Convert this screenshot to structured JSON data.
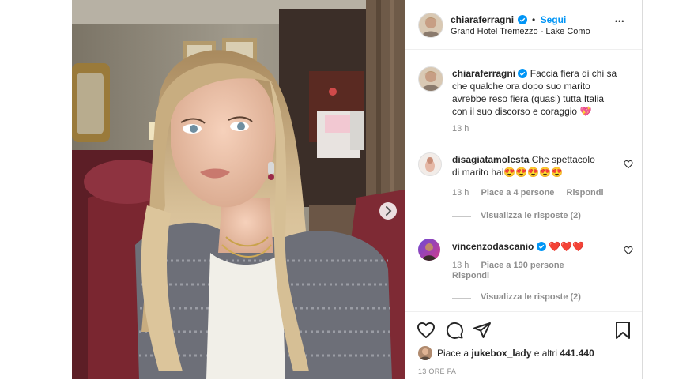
{
  "post": {
    "username": "chiaraferragni",
    "follow_label": "Segui",
    "location": "Grand Hotel Tremezzo - Lake Como",
    "more_label": "•••"
  },
  "caption": {
    "username": "chiaraferragni",
    "text_lines": [
      "Faccia fiera di chi sa",
      "che qualche ora dopo suo marito",
      "avrebbe reso fiera (quasi) tutta Italia",
      "con il suo discorso e coraggio"
    ],
    "emoji": "💖",
    "time": "13 h"
  },
  "comments": [
    {
      "username": "disagiatamolesta",
      "line1": "Che spettacolo",
      "line2": "di marito hai😍😍😍😍😍",
      "time": "13 h",
      "likes": "Piace a 4 persone",
      "reply": "Rispondi",
      "view_replies": "Visualizza le risposte (2)"
    },
    {
      "username": "vincenzodascanio",
      "line1": "❤️❤️❤️",
      "time": "13 h",
      "likes": "Piace a 190 persone",
      "reply": "Rispondi",
      "view_replies": "Visualizza le risposte (2)"
    }
  ],
  "likes_bar": {
    "prefix": "Piace a ",
    "user": "jukebox_lady",
    "suffix": " e altri ",
    "count": "441.440"
  },
  "post_time": "13 ORE FA",
  "colors": {
    "accent": "#0095f6",
    "text": "#262626",
    "muted": "#8e8e8e",
    "heart": "#ed4956"
  }
}
